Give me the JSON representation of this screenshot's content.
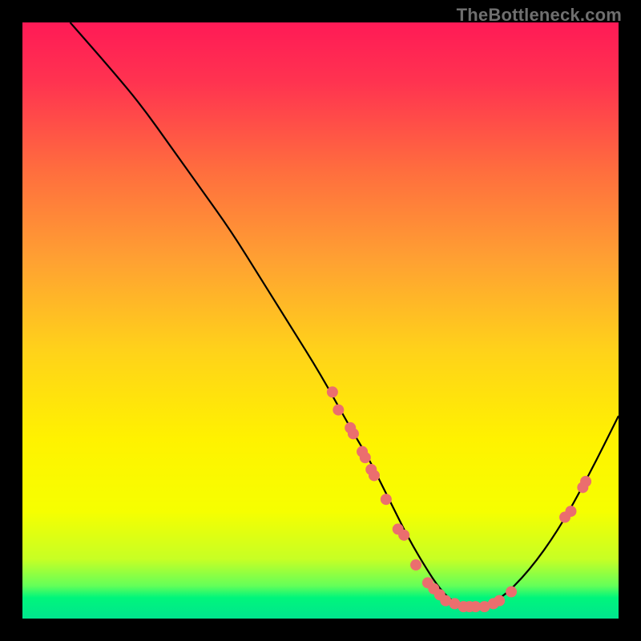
{
  "attribution": "TheBottleneck.com",
  "colors": {
    "background": "#000000",
    "curve_stroke": "#000000",
    "marker_fill": "#eb6e6e",
    "attribution_text": "#6f6f6f",
    "gradient_stops": [
      {
        "offset": 0.0,
        "color": "#ff1a56"
      },
      {
        "offset": 0.1,
        "color": "#ff3350"
      },
      {
        "offset": 0.25,
        "color": "#ff6e3e"
      },
      {
        "offset": 0.4,
        "color": "#ffa132"
      },
      {
        "offset": 0.55,
        "color": "#ffd21a"
      },
      {
        "offset": 0.7,
        "color": "#fff200"
      },
      {
        "offset": 0.82,
        "color": "#f6ff00"
      },
      {
        "offset": 0.9,
        "color": "#c7ff24"
      },
      {
        "offset": 0.945,
        "color": "#64ff59"
      },
      {
        "offset": 0.965,
        "color": "#00f57c"
      },
      {
        "offset": 1.0,
        "color": "#00e58e"
      }
    ]
  },
  "chart_data": {
    "type": "line",
    "title": "",
    "xlabel": "",
    "ylabel": "",
    "xlim": [
      0,
      100
    ],
    "ylim": [
      0,
      100
    ],
    "grid": false,
    "series": [
      {
        "name": "bottleneck-curve",
        "x": [
          8,
          15,
          20,
          25,
          30,
          35,
          40,
          45,
          50,
          55,
          58,
          60,
          62,
          65,
          68,
          70,
          72,
          74,
          76,
          80,
          85,
          90,
          95,
          100
        ],
        "y": [
          100,
          92,
          86,
          79,
          72,
          65,
          57,
          49,
          41,
          32,
          27,
          23,
          19,
          13,
          8,
          5,
          3,
          2,
          2,
          3,
          8,
          15,
          24,
          34
        ]
      }
    ],
    "markers": [
      {
        "x": 52,
        "y": 38
      },
      {
        "x": 53,
        "y": 35
      },
      {
        "x": 55,
        "y": 32
      },
      {
        "x": 55.5,
        "y": 31
      },
      {
        "x": 57,
        "y": 28
      },
      {
        "x": 57.5,
        "y": 27
      },
      {
        "x": 58.5,
        "y": 25
      },
      {
        "x": 59,
        "y": 24
      },
      {
        "x": 61,
        "y": 20
      },
      {
        "x": 63,
        "y": 15
      },
      {
        "x": 64,
        "y": 14
      },
      {
        "x": 66,
        "y": 9
      },
      {
        "x": 68,
        "y": 6
      },
      {
        "x": 69,
        "y": 5
      },
      {
        "x": 70,
        "y": 4
      },
      {
        "x": 71,
        "y": 3
      },
      {
        "x": 72.5,
        "y": 2.5
      },
      {
        "x": 74,
        "y": 2
      },
      {
        "x": 75,
        "y": 2
      },
      {
        "x": 76,
        "y": 2
      },
      {
        "x": 77.5,
        "y": 2
      },
      {
        "x": 79,
        "y": 2.5
      },
      {
        "x": 80,
        "y": 3
      },
      {
        "x": 82,
        "y": 4.5
      },
      {
        "x": 91,
        "y": 17
      },
      {
        "x": 92,
        "y": 18
      },
      {
        "x": 94,
        "y": 22
      },
      {
        "x": 94.5,
        "y": 23
      }
    ]
  }
}
